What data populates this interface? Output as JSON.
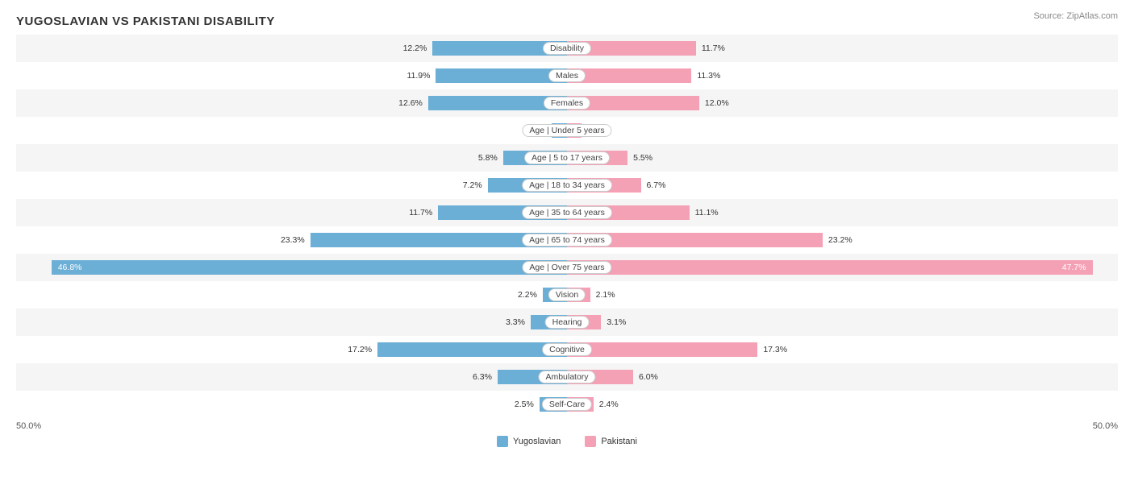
{
  "title": "YUGOSLAVIAN VS PAKISTANI DISABILITY",
  "source": "Source: ZipAtlas.com",
  "axis": {
    "left": "50.0%",
    "right": "50.0%"
  },
  "legend": {
    "yugoslavian": "Yugoslavian",
    "pakistani": "Pakistani",
    "yugoslavian_color": "#6baed6",
    "pakistani_color": "#f4a0b5"
  },
  "rows": [
    {
      "label": "Disability",
      "left_val": "12.2%",
      "right_val": "11.7%",
      "left_pct": 12.2,
      "right_pct": 11.7,
      "max": 50
    },
    {
      "label": "Males",
      "left_val": "11.9%",
      "right_val": "11.3%",
      "left_pct": 11.9,
      "right_pct": 11.3,
      "max": 50
    },
    {
      "label": "Females",
      "left_val": "12.6%",
      "right_val": "12.0%",
      "left_pct": 12.6,
      "right_pct": 12.0,
      "max": 50
    },
    {
      "label": "Age | Under 5 years",
      "left_val": "1.4%",
      "right_val": "1.3%",
      "left_pct": 1.4,
      "right_pct": 1.3,
      "max": 50
    },
    {
      "label": "Age | 5 to 17 years",
      "left_val": "5.8%",
      "right_val": "5.5%",
      "left_pct": 5.8,
      "right_pct": 5.5,
      "max": 50
    },
    {
      "label": "Age | 18 to 34 years",
      "left_val": "7.2%",
      "right_val": "6.7%",
      "left_pct": 7.2,
      "right_pct": 6.7,
      "max": 50
    },
    {
      "label": "Age | 35 to 64 years",
      "left_val": "11.7%",
      "right_val": "11.1%",
      "left_pct": 11.7,
      "right_pct": 11.1,
      "max": 50
    },
    {
      "label": "Age | 65 to 74 years",
      "left_val": "23.3%",
      "right_val": "23.2%",
      "left_pct": 23.3,
      "right_pct": 23.2,
      "max": 50
    },
    {
      "label": "Age | Over 75 years",
      "left_val": "46.8%",
      "right_val": "47.7%",
      "left_pct": 46.8,
      "right_pct": 47.7,
      "max": 50,
      "large": true
    },
    {
      "label": "Vision",
      "left_val": "2.2%",
      "right_val": "2.1%",
      "left_pct": 2.2,
      "right_pct": 2.1,
      "max": 50
    },
    {
      "label": "Hearing",
      "left_val": "3.3%",
      "right_val": "3.1%",
      "left_pct": 3.3,
      "right_pct": 3.1,
      "max": 50
    },
    {
      "label": "Cognitive",
      "left_val": "17.2%",
      "right_val": "17.3%",
      "left_pct": 17.2,
      "right_pct": 17.3,
      "max": 50
    },
    {
      "label": "Ambulatory",
      "left_val": "6.3%",
      "right_val": "6.0%",
      "left_pct": 6.3,
      "right_pct": 6.0,
      "max": 50
    },
    {
      "label": "Self-Care",
      "left_val": "2.5%",
      "right_val": "2.4%",
      "left_pct": 2.5,
      "right_pct": 2.4,
      "max": 50
    }
  ]
}
